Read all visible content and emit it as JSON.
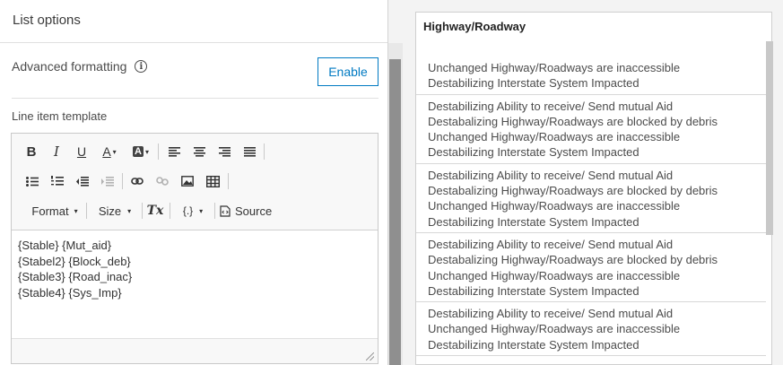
{
  "left": {
    "title": "List options",
    "advanced_label": "Advanced formatting",
    "info_glyph": "i",
    "enable_label": "Enable",
    "line_item_label": "Line item template",
    "toolbar": {
      "bold": "B",
      "italic": "I",
      "underline": "U",
      "font_color": "A",
      "bg_color": "A",
      "format_label": "Format",
      "size_label": "Size",
      "clear_format": "Tx",
      "placeholder": "{.}",
      "source_label": "Source"
    },
    "template_lines": [
      "{Stable} {Mut_aid}",
      "{Stabel2} {Block_deb}",
      "{Stable3} {Road_inac}",
      "{Stable4} {Sys_Imp}"
    ]
  },
  "right": {
    "title": "Highway/Roadway",
    "items": [
      [
        "Unchanged Highway/Roadways are inaccessible",
        "Destabilizing Interstate System Impacted"
      ],
      [
        "Destabilizing Ability to receive/ Send mutual Aid",
        "Destabalizing Highway/Roadways are blocked by debris",
        "Unchanged Highway/Roadways are inaccessible",
        "Destabilizing Interstate System Impacted"
      ],
      [
        "Destabilizing Ability to receive/ Send mutual Aid",
        "Destabalizing Highway/Roadways are blocked by debris",
        "Unchanged Highway/Roadways are inaccessible",
        "Destabilizing Interstate System Impacted"
      ],
      [
        "Destabilizing Ability to receive/ Send mutual Aid",
        "Destabalizing Highway/Roadways are blocked by debris",
        "Unchanged Highway/Roadways are inaccessible",
        "Destabilizing Interstate System Impacted"
      ],
      [
        "Destabilizing Ability to receive/ Send mutual Aid",
        "Unchanged Highway/Roadways are inaccessible",
        "Destabilizing Interstate System Impacted"
      ]
    ]
  },
  "colors": {
    "accent": "#007ac2"
  }
}
